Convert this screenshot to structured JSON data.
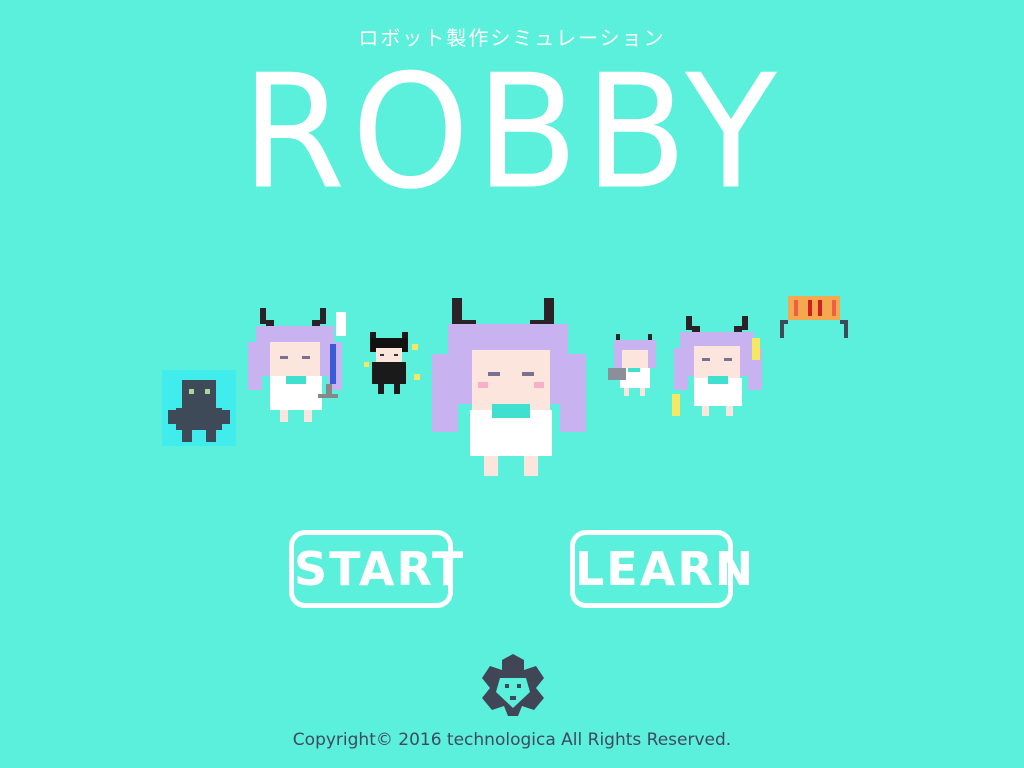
{
  "game": {
    "subtitle": "ロボット製作シミュレーション",
    "title": "ROBBY"
  },
  "menu": {
    "start_label": "START",
    "learn_label": "LEARN"
  },
  "footer": {
    "copyright": "Copyright© 2016 technologica  All Rights Reserved."
  },
  "colors": {
    "background": "#5af0dc",
    "text": "#ffffff",
    "footer_text": "#3f4a5c",
    "hair": "#c8b2f0",
    "horn": "#2a2226",
    "logo": "#404656"
  },
  "sprites": {
    "characters": [
      "robot-silhouette-icon",
      "girl-wrench-icon",
      "dark-girl-icon",
      "girl-main-icon",
      "girl-laptop-icon",
      "girl-lightning-icon",
      "bow-item-icon"
    ]
  }
}
